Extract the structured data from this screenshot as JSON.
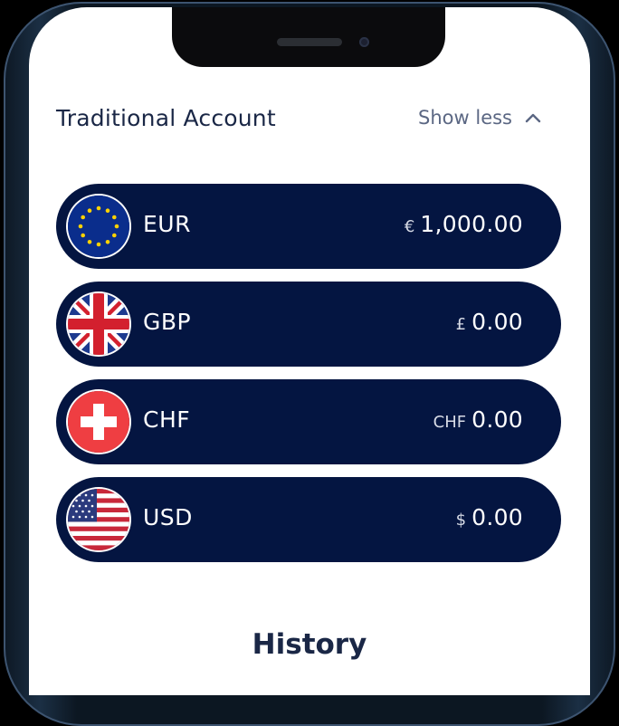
{
  "account": {
    "title": "Traditional Account",
    "toggle_label": "Show less"
  },
  "currencies": [
    {
      "code": "EUR",
      "symbol": "€",
      "amount": "1,000.00",
      "flag": "eu-flag-icon"
    },
    {
      "code": "GBP",
      "symbol": "£",
      "amount": "0.00",
      "flag": "uk-flag-icon"
    },
    {
      "code": "CHF",
      "symbol": "CHF",
      "amount": "0.00",
      "flag": "swiss-flag-icon"
    },
    {
      "code": "USD",
      "symbol": "$",
      "amount": "0.00",
      "flag": "us-flag-icon"
    }
  ],
  "history": {
    "title": "History"
  },
  "colors": {
    "row_background": "#041541",
    "title_text": "#1a2746",
    "toggle_text": "#5b6783"
  }
}
